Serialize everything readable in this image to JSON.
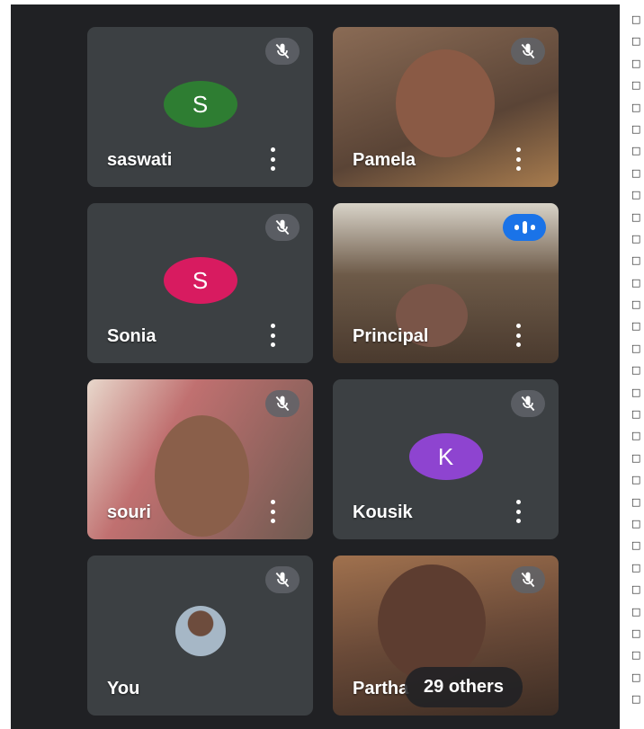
{
  "participants": [
    {
      "name": "saswati",
      "initial": "S",
      "avatar_color": "#2e7d32"
    },
    {
      "name": "Pamela"
    },
    {
      "name": "Sonia",
      "initial": "S",
      "avatar_color": "#d81b60"
    },
    {
      "name": "Principal"
    },
    {
      "name": "souri"
    },
    {
      "name": "Kousik",
      "initial": "K",
      "avatar_color": "#8e44d0"
    },
    {
      "name": "You"
    },
    {
      "name": "Partha"
    }
  ],
  "overflow": {
    "label": "29 others"
  },
  "edge_glyph": "□",
  "icons": {
    "mute": "mic-off-icon",
    "speaking": "audio-level-icon",
    "more": "more-vert-icon"
  }
}
